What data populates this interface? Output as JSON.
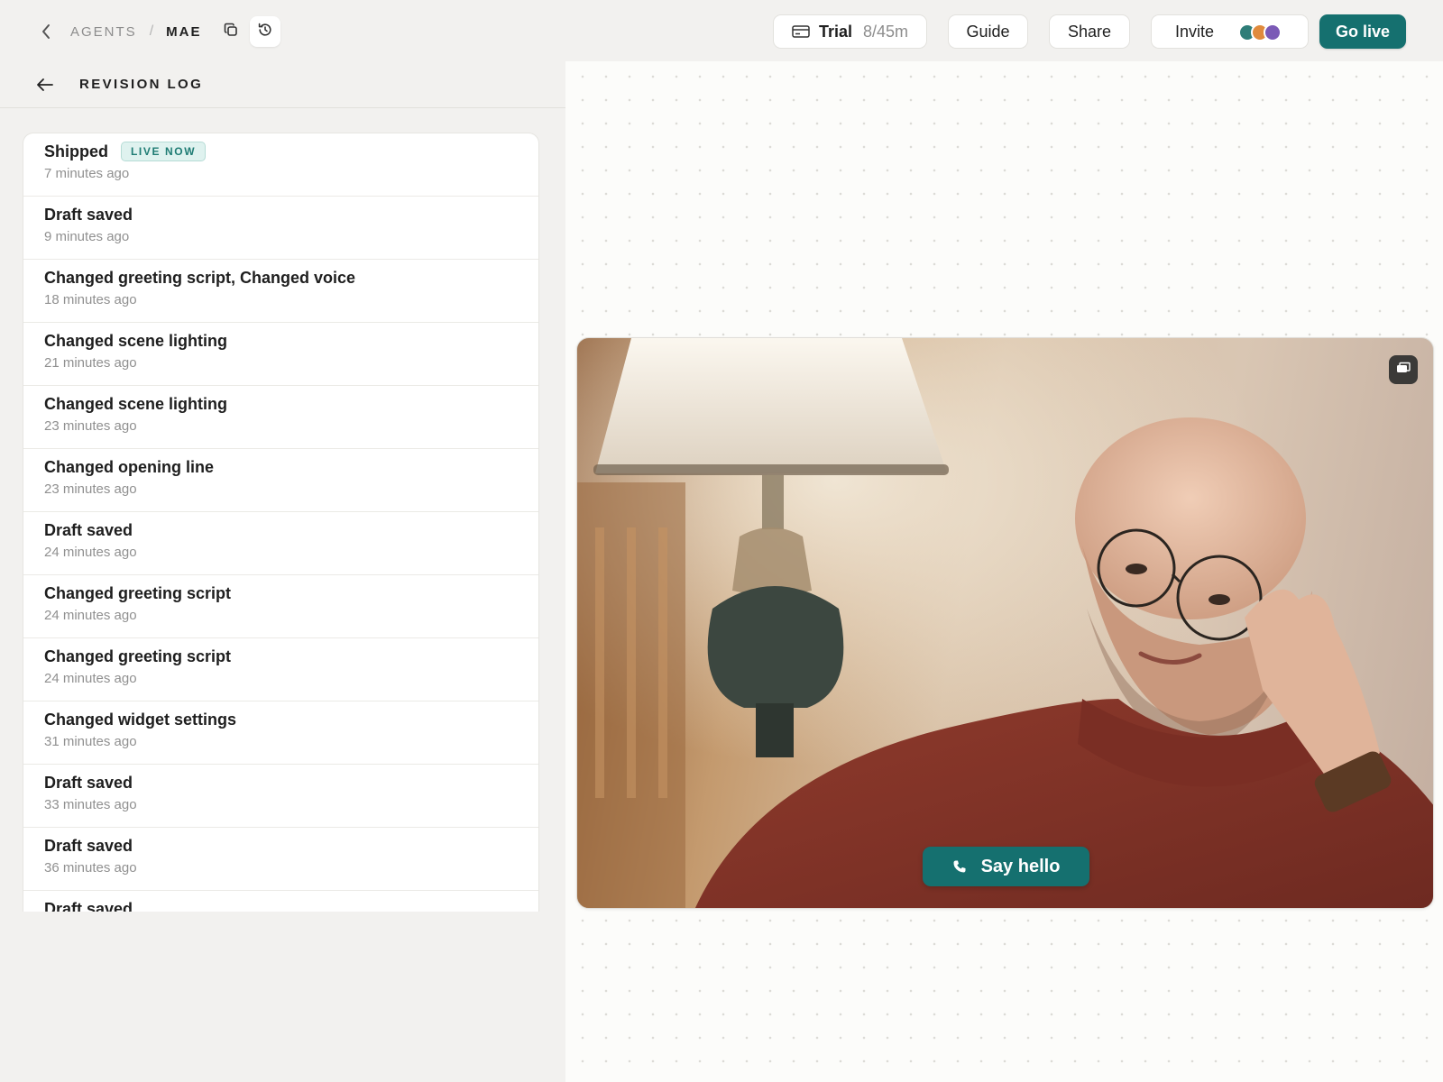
{
  "breadcrumb": {
    "agents_label": "AGENTS",
    "separator": "/",
    "agent_name": "MAE"
  },
  "topbar": {
    "trial_label": "Trial",
    "trial_usage": "8/45m",
    "guide_label": "Guide",
    "share_label": "Share",
    "invite_label": "Invite",
    "go_live_label": "Go live",
    "avatar_colors": [
      "#2e7d78",
      "#e08a3c",
      "#7b5ab6"
    ]
  },
  "panel": {
    "title": "REVISION LOG"
  },
  "revisions": [
    {
      "title": "Shipped",
      "time": "7 minutes ago",
      "badge": "LIVE NOW"
    },
    {
      "title": "Draft saved",
      "time": "9 minutes ago"
    },
    {
      "title": "Changed greeting script, Changed voice",
      "time": "18 minutes ago"
    },
    {
      "title": "Changed scene lighting",
      "time": "21 minutes ago"
    },
    {
      "title": "Changed scene lighting",
      "time": "23 minutes ago"
    },
    {
      "title": "Changed opening line",
      "time": "23 minutes ago"
    },
    {
      "title": "Draft saved",
      "time": "24 minutes ago"
    },
    {
      "title": "Changed greeting script",
      "time": "24 minutes ago"
    },
    {
      "title": "Changed greeting script",
      "time": "24 minutes ago"
    },
    {
      "title": "Changed widget settings",
      "time": "31 minutes ago"
    },
    {
      "title": "Draft saved",
      "time": "33 minutes ago"
    },
    {
      "title": "Draft saved",
      "time": "36 minutes ago"
    },
    {
      "title": "Draft saved",
      "time": ""
    }
  ],
  "preview": {
    "cta_label": "Say hello"
  },
  "colors": {
    "accent": "#15706f",
    "badge_bg": "#dff2ef",
    "badge_text": "#1f7c74"
  }
}
